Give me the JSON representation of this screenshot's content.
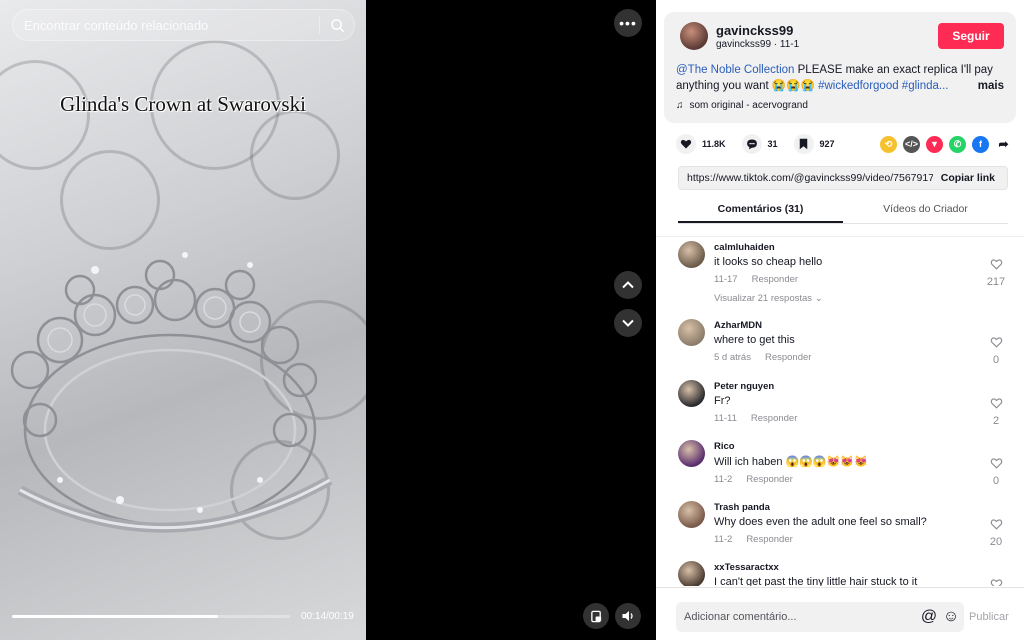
{
  "search": {
    "placeholder": "Encontrar conteúdo relacionado"
  },
  "video": {
    "overlay_title": "Glinda's Crown at Swarovski",
    "time": "00:14/00:19",
    "progress": 0.74
  },
  "author": {
    "handle": "gavinckss99",
    "sub": "gavinckss99 · 11-1",
    "follow_label": "Seguir",
    "desc_mention": "@The Noble Collection",
    "desc_text": " PLEASE make an exact replica I'll pay anything you want 😭😭😭 ",
    "desc_tags": "#wickedforgood #glinda...",
    "desc_more": "mais",
    "music": "som original - acervogrand"
  },
  "stats": {
    "likes": "11.8K",
    "comments": "31",
    "saves": "927"
  },
  "share_icons": [
    "repost-icon",
    "embed-icon",
    "send-icon",
    "whatsapp-icon",
    "facebook-icon",
    "share-arrow-icon"
  ],
  "link": {
    "url": "https://www.tiktok.com/@gavinckss99/video/7567917...",
    "copy_label": "Copiar link"
  },
  "tabs": [
    {
      "label": "Comentários (31)",
      "active": true
    },
    {
      "label": "Vídeos do Criador",
      "active": false
    }
  ],
  "comments": [
    {
      "user": "calmluhaiden",
      "text": "it looks so cheap hello",
      "date": "11-17",
      "reply": "Responder",
      "likes": "217",
      "view_replies": "Visualizar 21 respostas",
      "avatar_color": "#6b5a4a"
    },
    {
      "user": "AzharMDN",
      "text": "where to get this",
      "date": "5 d atrás",
      "reply": "Responder",
      "likes": "0",
      "avatar_color": "#8a7d6a"
    },
    {
      "user": "Peter nguyen",
      "text": "Fr?",
      "date": "11-11",
      "reply": "Responder",
      "likes": "2",
      "avatar_color": "#2a2a2e"
    },
    {
      "user": "Rico",
      "text": "Will ich haben 😱😱😱😻😻😻",
      "date": "11-2",
      "reply": "Responder",
      "likes": "0",
      "avatar_color": "#5a2d6e"
    },
    {
      "user": "Trash panda",
      "text": "Why does even the adult one feel so small?",
      "date": "11-2",
      "reply": "Responder",
      "likes": "20",
      "avatar_color": "#7a5a4a"
    },
    {
      "user": "xxTessaractxx",
      "text": "I can't get past the tiny little hair stuck to it",
      "date": "",
      "reply": "",
      "likes": "",
      "avatar_color": "#4a3a30"
    }
  ],
  "composer": {
    "placeholder": "Adicionar comentário...",
    "publish_label": "Publicar"
  }
}
